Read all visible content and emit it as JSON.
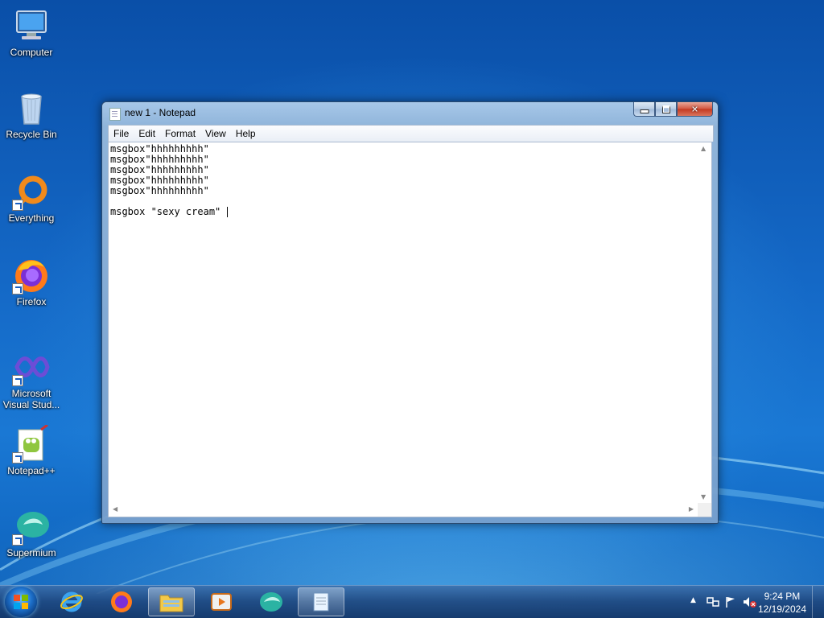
{
  "desktop": {
    "icons": [
      {
        "label": "Computer"
      },
      {
        "label": "Recycle Bin"
      },
      {
        "label": "Everything"
      },
      {
        "label": "Firefox"
      },
      {
        "label": "Microsoft Visual Stud..."
      },
      {
        "label": "Notepad++"
      },
      {
        "label": "Supermium"
      }
    ]
  },
  "window": {
    "title": "new 1 - Notepad",
    "menu": [
      "File",
      "Edit",
      "Format",
      "View",
      "Help"
    ],
    "content_lines": [
      "msgbox\"hhhhhhhhh\"",
      "msgbox\"hhhhhhhhh\"",
      "msgbox\"hhhhhhhhh\"",
      "msgbox\"hhhhhhhhh\"",
      "msgbox\"hhhhhhhhh\"",
      "",
      "msgbox \"sexy cream\" "
    ]
  },
  "taskbar": {
    "pinned": [
      "Internet Explorer",
      "Firefox",
      "File Explorer",
      "Media Player",
      "Supermium",
      "Notepad"
    ],
    "clock_time": "9:24 PM",
    "clock_date": "12/19/2024"
  },
  "colors": {
    "desktop_blue": "#1468c6",
    "taskbar": "#1e467d",
    "close_red": "#c4381f"
  }
}
